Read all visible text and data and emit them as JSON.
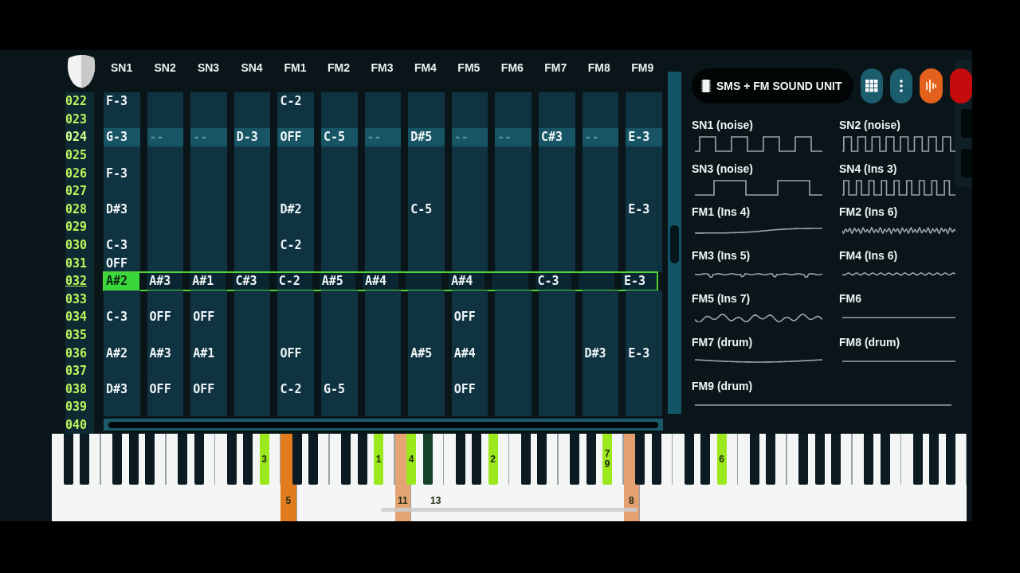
{
  "tracker": {
    "channels": [
      {
        "name": "SN1",
        "selected": true
      },
      {
        "name": "SN2",
        "selected": false
      },
      {
        "name": "SN3",
        "selected": false
      },
      {
        "name": "SN4",
        "selected": false
      },
      {
        "name": "FM1",
        "selected": false
      },
      {
        "name": "FM2",
        "selected": false
      },
      {
        "name": "FM3",
        "selected": false
      },
      {
        "name": "FM4",
        "selected": false
      },
      {
        "name": "FM5",
        "selected": false
      },
      {
        "name": "FM6",
        "selected": false
      },
      {
        "name": "FM7",
        "selected": false
      },
      {
        "name": "FM8",
        "selected": false
      },
      {
        "name": "FM9",
        "selected": false
      }
    ],
    "rows": [
      {
        "number": "022",
        "highlighted": false,
        "cursor": false,
        "cells": [
          "F-3",
          null,
          null,
          null,
          "C-2",
          null,
          null,
          null,
          null,
          null,
          null,
          null,
          null
        ]
      },
      {
        "number": "023",
        "highlighted": false,
        "cursor": false,
        "cells": [
          null,
          null,
          null,
          null,
          null,
          null,
          null,
          null,
          null,
          null,
          null,
          null,
          null
        ]
      },
      {
        "number": "024",
        "highlighted": true,
        "cursor": false,
        "cells": [
          "G-3",
          "--",
          "--",
          "D-3",
          "OFF",
          "C-5",
          "--",
          "D#5",
          "--",
          "--",
          "C#3",
          "--",
          "E-3"
        ]
      },
      {
        "number": "025",
        "highlighted": false,
        "cursor": false,
        "cells": [
          null,
          null,
          null,
          null,
          null,
          null,
          null,
          null,
          null,
          null,
          null,
          null,
          null
        ]
      },
      {
        "number": "026",
        "highlighted": false,
        "cursor": false,
        "cells": [
          "F-3",
          null,
          null,
          null,
          null,
          null,
          null,
          null,
          null,
          null,
          null,
          null,
          null
        ]
      },
      {
        "number": "027",
        "highlighted": false,
        "cursor": false,
        "cells": [
          null,
          null,
          null,
          null,
          null,
          null,
          null,
          null,
          null,
          null,
          null,
          null,
          null
        ]
      },
      {
        "number": "028",
        "highlighted": false,
        "cursor": false,
        "cells": [
          "D#3",
          null,
          null,
          null,
          "D#2",
          null,
          null,
          "C-5",
          null,
          null,
          null,
          null,
          "E-3"
        ]
      },
      {
        "number": "029",
        "highlighted": false,
        "cursor": false,
        "cells": [
          null,
          null,
          null,
          null,
          null,
          null,
          null,
          null,
          null,
          null,
          null,
          null,
          null
        ]
      },
      {
        "number": "030",
        "highlighted": false,
        "cursor": false,
        "cells": [
          "C-3",
          null,
          null,
          null,
          "C-2",
          null,
          null,
          null,
          null,
          null,
          null,
          null,
          null
        ]
      },
      {
        "number": "031",
        "highlighted": false,
        "cursor": false,
        "cells": [
          "OFF",
          null,
          null,
          null,
          null,
          null,
          null,
          null,
          null,
          null,
          null,
          null,
          null
        ]
      },
      {
        "number": "032",
        "highlighted": false,
        "cursor": true,
        "cells": [
          "A#2",
          "A#3",
          "A#1",
          "C#3",
          "C-2",
          "A#5",
          "A#4",
          null,
          "A#4",
          null,
          "C-3",
          null,
          "E-3"
        ]
      },
      {
        "number": "033",
        "highlighted": false,
        "cursor": false,
        "cells": [
          null,
          null,
          null,
          null,
          null,
          null,
          null,
          null,
          null,
          null,
          null,
          null,
          null
        ]
      },
      {
        "number": "034",
        "highlighted": false,
        "cursor": false,
        "cells": [
          "C-3",
          "OFF",
          "OFF",
          null,
          null,
          null,
          null,
          null,
          "OFF",
          null,
          null,
          null,
          null
        ]
      },
      {
        "number": "035",
        "highlighted": false,
        "cursor": false,
        "cells": [
          null,
          null,
          null,
          null,
          null,
          null,
          null,
          null,
          null,
          null,
          null,
          null,
          null
        ]
      },
      {
        "number": "036",
        "highlighted": false,
        "cursor": false,
        "cells": [
          "A#2",
          "A#3",
          "A#1",
          null,
          "OFF",
          null,
          null,
          "A#5",
          "A#4",
          null,
          null,
          "D#3",
          "E-3"
        ]
      },
      {
        "number": "037",
        "highlighted": false,
        "cursor": false,
        "cells": [
          null,
          null,
          null,
          null,
          null,
          null,
          null,
          null,
          null,
          null,
          null,
          null,
          null
        ]
      },
      {
        "number": "038",
        "highlighted": false,
        "cursor": false,
        "cells": [
          "D#3",
          "OFF",
          "OFF",
          null,
          "C-2",
          "G-5",
          null,
          null,
          "OFF",
          null,
          null,
          null,
          null
        ]
      },
      {
        "number": "039",
        "highlighted": false,
        "cursor": false,
        "cells": [
          null,
          null,
          null,
          null,
          null,
          null,
          null,
          null,
          null,
          null,
          null,
          null,
          null
        ]
      },
      {
        "number": "040",
        "highlighted": false,
        "cursor": false
      }
    ]
  },
  "toolbar": {
    "title": "SMS + FM SOUND UNIT",
    "buttons": [
      {
        "kind": "grid"
      },
      {
        "kind": "more"
      },
      {
        "kind": "waveform"
      },
      {
        "kind": "record"
      }
    ]
  },
  "scopes": [
    {
      "label": "SN1 (noise)",
      "kind": "square"
    },
    {
      "label": "SN2 (noise)",
      "kind": "square_fast"
    },
    {
      "label": "SN3 (noise)",
      "kind": "square_slow"
    },
    {
      "label": "SN4 (Ins 3)",
      "kind": "pulse"
    },
    {
      "label": "FM1 (Ins 4)",
      "kind": "swell"
    },
    {
      "label": "FM2 (Ins 6)",
      "kind": "ripple"
    },
    {
      "label": "FM3 (Ins 5)",
      "kind": "dips"
    },
    {
      "label": "FM4 (Ins 6)",
      "kind": "ripple_small"
    },
    {
      "label": "FM5 (Ins 7)",
      "kind": "wobble"
    },
    {
      "label": "FM6",
      "kind": "flat"
    },
    {
      "label": "FM7 (drum)",
      "kind": "sag"
    },
    {
      "label": "FM8 (drum)",
      "kind": "flat"
    },
    {
      "label": "FM9 (drum)",
      "kind": "flat"
    }
  ],
  "keyboard": {
    "octaves": [
      {
        "keys": [
          {
            "kind": "white"
          },
          {
            "kind": "black"
          },
          {
            "kind": "white"
          },
          {
            "kind": "black"
          },
          {
            "kind": "white"
          },
          {
            "kind": "white"
          },
          {
            "kind": "black"
          },
          {
            "kind": "white"
          },
          {
            "kind": "black"
          },
          {
            "kind": "white"
          },
          {
            "kind": "black"
          },
          {
            "kind": "white"
          }
        ]
      },
      {
        "keys": [
          {
            "kind": "white"
          },
          {
            "kind": "black"
          },
          {
            "kind": "white"
          },
          {
            "kind": "black"
          },
          {
            "kind": "white"
          },
          {
            "kind": "white"
          },
          {
            "kind": "black"
          },
          {
            "kind": "white"
          },
          {
            "kind": "black"
          },
          {
            "kind": "white"
          },
          {
            "kind": "black",
            "labels": [
              "3"
            ],
            "color": "#9be81c"
          },
          {
            "kind": "white"
          }
        ]
      },
      {
        "keys": [
          {
            "kind": "white",
            "labels": [
              "5"
            ],
            "color": "#e07b1e"
          },
          {
            "kind": "black"
          },
          {
            "kind": "white"
          },
          {
            "kind": "black"
          },
          {
            "kind": "white"
          },
          {
            "kind": "white"
          },
          {
            "kind": "black"
          },
          {
            "kind": "white"
          },
          {
            "kind": "black"
          },
          {
            "kind": "white"
          },
          {
            "kind": "black",
            "labels": [
              "1"
            ],
            "color": "#9be81c"
          },
          {
            "kind": "white"
          }
        ]
      },
      {
        "keys": [
          {
            "kind": "white",
            "labels": [
              "11"
            ],
            "color": "#e4a474"
          },
          {
            "kind": "black",
            "labels": [
              "4"
            ],
            "color": "#9be81c"
          },
          {
            "kind": "white"
          },
          {
            "kind": "black",
            "color": "#16402a"
          },
          {
            "kind": "white",
            "labels": [
              "13"
            ]
          },
          {
            "kind": "white"
          },
          {
            "kind": "black"
          },
          {
            "kind": "white"
          },
          {
            "kind": "black"
          },
          {
            "kind": "white"
          },
          {
            "kind": "black",
            "labels": [
              "2"
            ],
            "color": "#9be81c"
          },
          {
            "kind": "white"
          }
        ]
      },
      {
        "keys": [
          {
            "kind": "white"
          },
          {
            "kind": "black"
          },
          {
            "kind": "white"
          },
          {
            "kind": "black"
          },
          {
            "kind": "white"
          },
          {
            "kind": "white"
          },
          {
            "kind": "black"
          },
          {
            "kind": "white"
          },
          {
            "kind": "black"
          },
          {
            "kind": "white"
          },
          {
            "kind": "black",
            "labels": [
              "7",
              "9"
            ],
            "color": "#9be81c"
          },
          {
            "kind": "white"
          }
        ]
      },
      {
        "keys": [
          {
            "kind": "white",
            "labels": [
              "8"
            ],
            "color": "#e4a070"
          },
          {
            "kind": "black"
          },
          {
            "kind": "white"
          },
          {
            "kind": "black"
          },
          {
            "kind": "white"
          },
          {
            "kind": "white"
          },
          {
            "kind": "black"
          },
          {
            "kind": "white"
          },
          {
            "kind": "black"
          },
          {
            "kind": "white"
          },
          {
            "kind": "black",
            "labels": [
              "6"
            ],
            "color": "#9be81c"
          },
          {
            "kind": "white"
          }
        ]
      },
      {
        "keys": [
          {
            "kind": "white"
          },
          {
            "kind": "black"
          },
          {
            "kind": "white"
          },
          {
            "kind": "black"
          },
          {
            "kind": "white"
          },
          {
            "kind": "white"
          },
          {
            "kind": "black"
          },
          {
            "kind": "white"
          },
          {
            "kind": "black"
          },
          {
            "kind": "white"
          },
          {
            "kind": "black"
          },
          {
            "kind": "white"
          }
        ]
      },
      {
        "keys": [
          {
            "kind": "white"
          },
          {
            "kind": "black"
          },
          {
            "kind": "white"
          },
          {
            "kind": "black"
          },
          {
            "kind": "white"
          },
          {
            "kind": "white"
          },
          {
            "kind": "black"
          },
          {
            "kind": "white"
          },
          {
            "kind": "black"
          },
          {
            "kind": "white"
          },
          {
            "kind": "black"
          },
          {
            "kind": "white"
          }
        ]
      }
    ]
  }
}
